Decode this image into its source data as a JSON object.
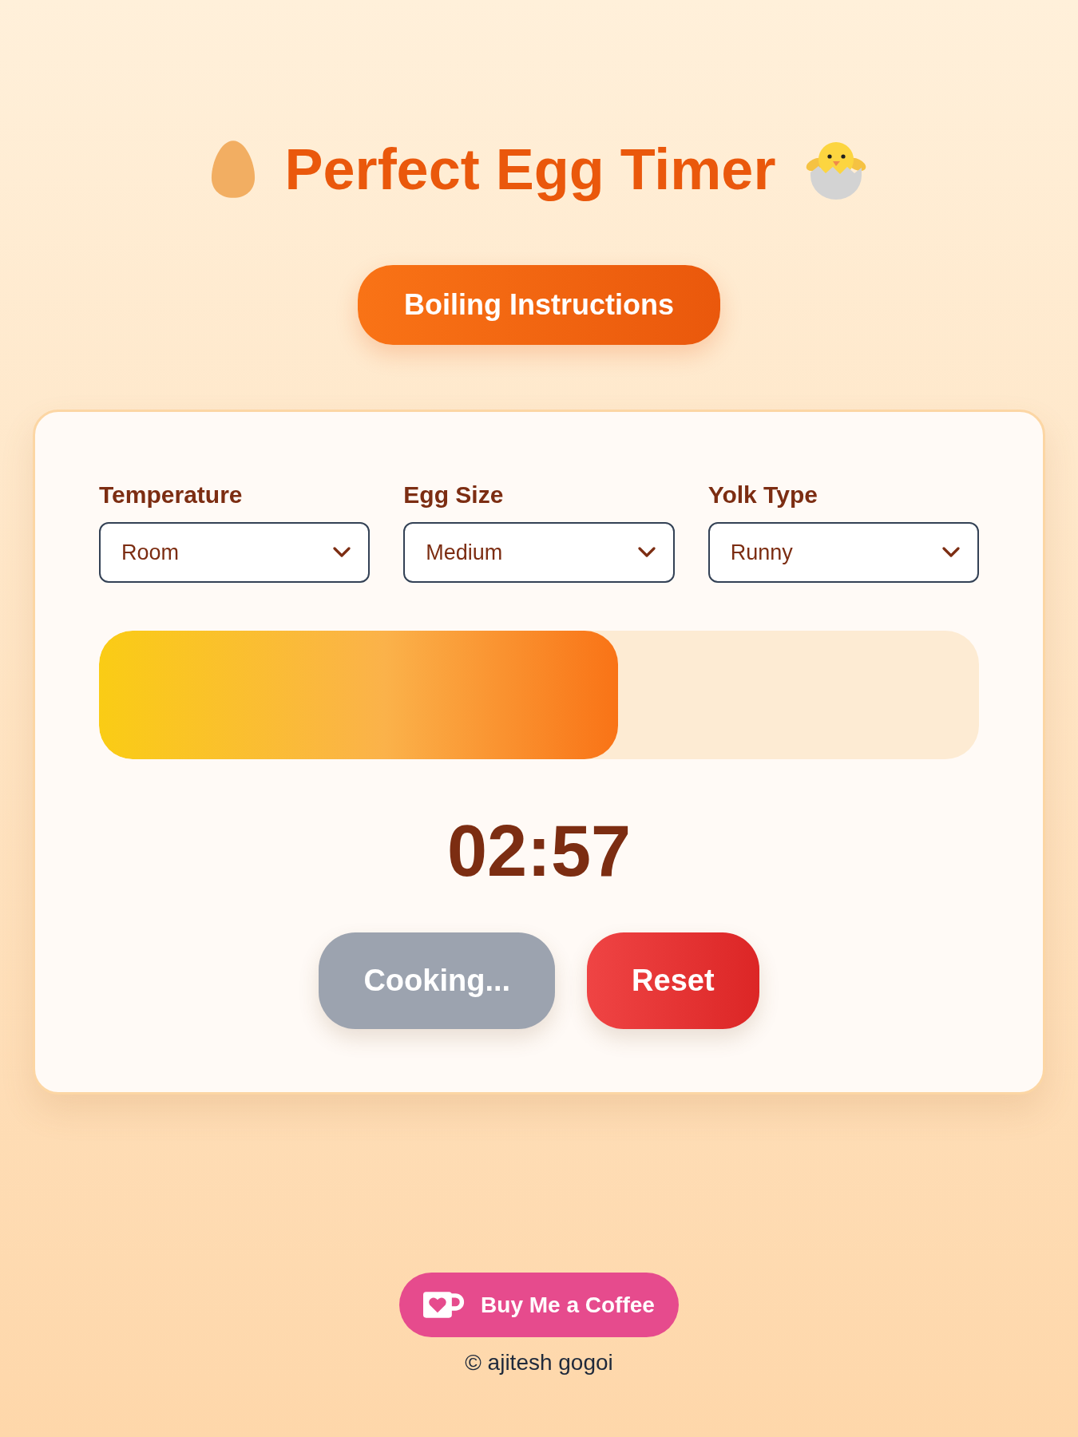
{
  "header": {
    "title": "Perfect Egg Timer"
  },
  "instructions_button": {
    "label": "Boiling Instructions"
  },
  "settings": [
    {
      "label": "Temperature",
      "value": "Room"
    },
    {
      "label": "Egg Size",
      "value": "Medium"
    },
    {
      "label": "Yolk Type",
      "value": "Runny"
    }
  ],
  "progress": {
    "level": 0.59
  },
  "timer": {
    "time": "02:57"
  },
  "buttons": [
    {
      "label": "Cooking...",
      "kind": "start",
      "disabled": true
    },
    {
      "label": "Reset",
      "kind": "reset",
      "disabled": false
    }
  ],
  "footer": {
    "support_button": {
      "label": "Buy Me a Coffee"
    },
    "copyright": "© ajitesh gogoi"
  }
}
